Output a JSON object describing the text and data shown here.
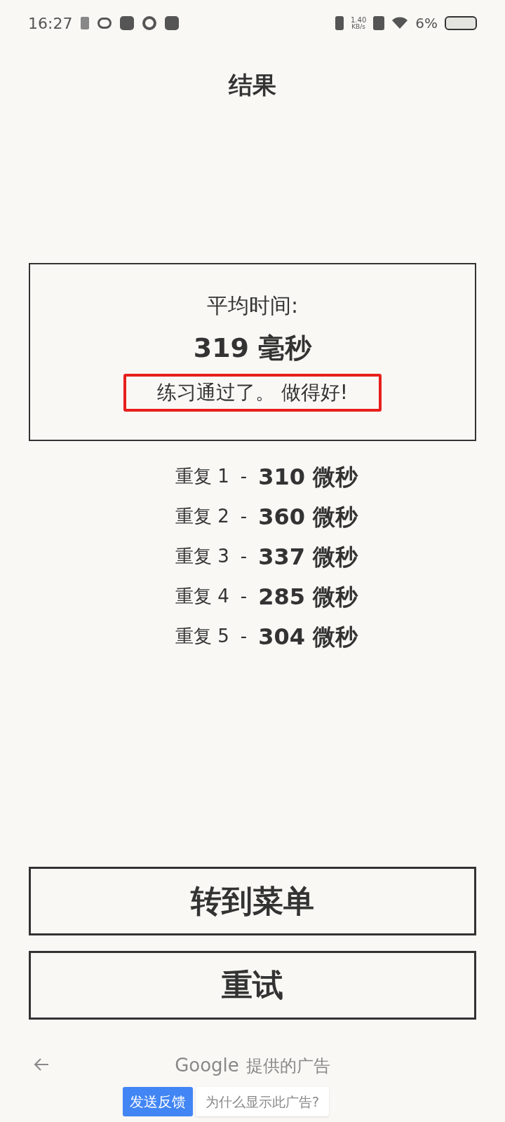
{
  "status_bar": {
    "time": "16:27",
    "net_speed": "1.40",
    "net_unit": "KB/s",
    "battery": "6%"
  },
  "title": "结果",
  "summary": {
    "label": "平均时间:",
    "value": "319 毫秒",
    "message": "练习通过了。 做得好!",
    "message_highlighted": true
  },
  "repeats": [
    {
      "label": "重复 1",
      "separator": "-",
      "value": "310 微秒"
    },
    {
      "label": "重复 2",
      "separator": "-",
      "value": "360 微秒"
    },
    {
      "label": "重复 3",
      "separator": "-",
      "value": "337 微秒"
    },
    {
      "label": "重复 4",
      "separator": "-",
      "value": "285 微秒"
    },
    {
      "label": "重复 5",
      "separator": "-",
      "value": "304 微秒"
    }
  ],
  "buttons": [
    "转到菜单",
    "重试"
  ],
  "ad_bar": {
    "brand": "Google",
    "caption": "提供的广告",
    "feedback_button": "发送反馈",
    "why_button": "为什么显示此广告?"
  }
}
